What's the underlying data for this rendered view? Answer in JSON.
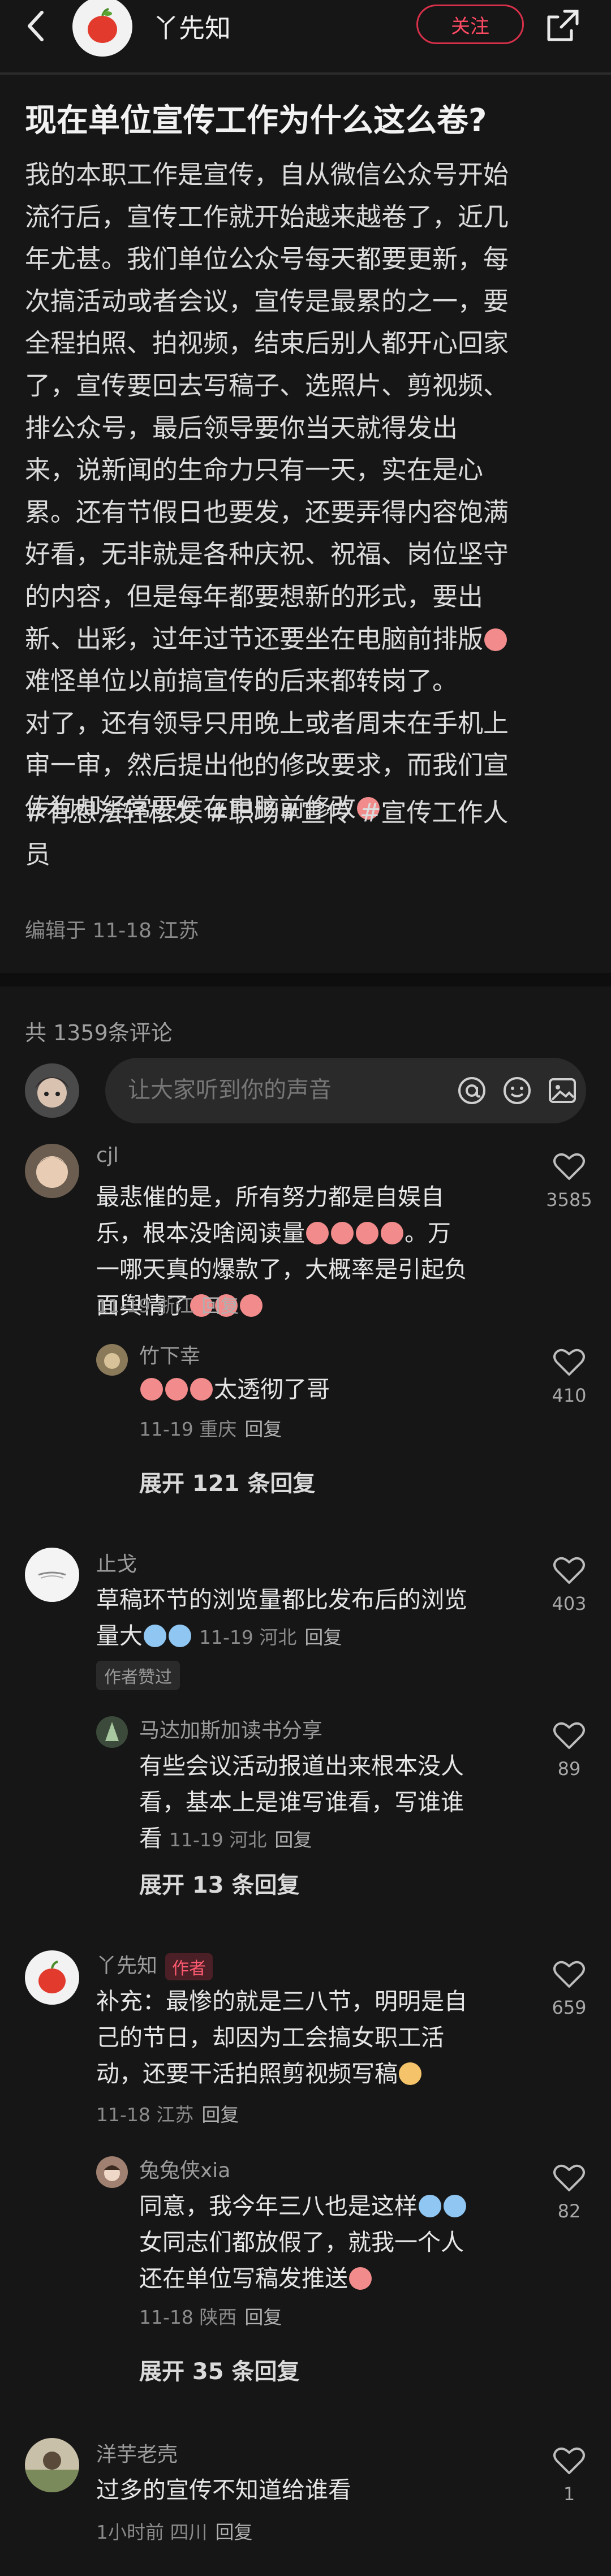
{
  "header": {
    "author_name": "丫先知",
    "follow_label": "关注"
  },
  "post": {
    "title": "现在单位宣传工作为什么这么卷?",
    "lines": [
      "我的本职工作是宣传，自从微信公众号开始",
      "流行后，宣传工作就开始越来越卷了，近几",
      "年尤甚。我们单位公众号每天都要更新，每",
      "次搞活动或者会议，宣传是最累的之一，要",
      "全程拍照、拍视频，结束后别人都开心回家",
      "了，宣传要回去写稿子、选照片、剪视频、",
      "排公众号，最后领导要你当天就得发出",
      "来，说新闻的生命力只有一天，实在是心",
      "累。还有节假日也要发，还要弄得内容饱满",
      "好看，无非就是各种庆祝、祝福、岗位坚守",
      "的内容，但是每年都要想新的形式，要出",
      "新、出彩，过年过节还要坐在电脑前排版",
      "难怪单位以前搞宣传的后来都转岗了。",
      "对了，还有领导只用晚上或者周末在手机上",
      "审一审，然后提出他的修改要求，而我们宣",
      "传狗却经常要侯在电脑前修改"
    ],
    "tags_line1": "#有想法轻松发 #职场#宣传 #宣传工作人",
    "tags_line2": "员",
    "edited": "编辑于 11-18 江苏"
  },
  "comments_header": {
    "count_label": "共 1359条评论",
    "input_placeholder": "让大家听到你的声音"
  },
  "comments": [
    {
      "name": "cjl",
      "lines": [
        "最悲催的是，所有努力都是自娱自",
        "乐，根本没啥阅读量",
        "。万",
        "一哪天真的爆款了，大概率是引起负",
        "面舆情了"
      ],
      "date": "11-19 浙江",
      "reply_label": "回复",
      "likes": "3585",
      "reply": {
        "name": "竹下幸",
        "text": "太透彻了哥",
        "date": "11-19 重庆",
        "reply_label": "回复",
        "likes": "410"
      },
      "expand": "展开 121 条回复"
    },
    {
      "name": "止戈",
      "lines": [
        "草稿环节的浏览量都比发布后的浏览",
        "量大"
      ],
      "date": "11-19 河北",
      "reply_label": "回复",
      "likes": "403",
      "praise": "作者赞过",
      "reply": {
        "name": "马达加斯加读书分享",
        "lines": [
          "有些会议活动报道出来根本没人",
          "看，基本上是谁写谁看，写谁谁",
          "看"
        ],
        "date": "11-19 河北",
        "reply_label": "回复",
        "likes": "89"
      },
      "expand": "展开 13 条回复"
    },
    {
      "name": "丫先知",
      "author_badge": "作者",
      "lines": [
        "补充：最惨的就是三八节，明明是自",
        "己的节日，却因为工会搞女职工活",
        "动，还要干活拍照剪视频写稿"
      ],
      "date": "11-18 江苏",
      "reply_label": "回复",
      "likes": "659",
      "reply": {
        "name": "兔兔侠xia",
        "lines": [
          "同意，我今年三八也是这样",
          "女同志们都放假了，就我一个人",
          "还在单位写稿发推送"
        ],
        "date": "11-18 陕西",
        "reply_label": "回复",
        "likes": "82"
      },
      "expand": "展开 35 条回复"
    },
    {
      "name": "洋芋老壳",
      "lines": [
        "过多的宣传不知道给谁看"
      ],
      "date": "1小时前 四川",
      "reply_label": "回复",
      "likes": "1"
    }
  ],
  "colors": {
    "background": "#161616",
    "accent": "#ff4a64"
  }
}
